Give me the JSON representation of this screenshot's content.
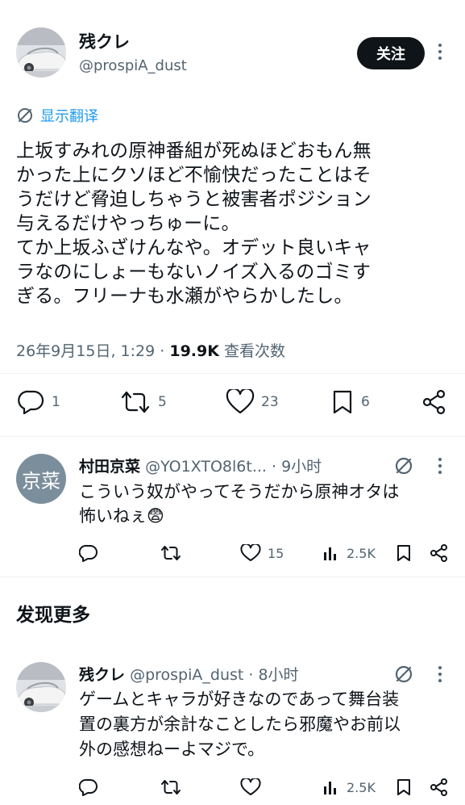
{
  "main_tweet": {
    "author_name": "残クレ",
    "author_handle": "@prospiA_dust",
    "follow_label": "关注",
    "translate_label": "显示翻译",
    "lines": [
      "上坂すみれの原神番組が死ぬほどおもん無",
      "かった上にクソほど不愉快だったことはそ",
      "うだけど脅迫しちゃうと被害者ポジション",
      "与えるだけやっちゅーに。",
      "てか上坂ふざけんなや。オデット良いキャ",
      "ラなのにしょーもないノイズ入るのゴミす",
      "ぎる。フリーナも水瀬がやらかしたし。"
    ],
    "timestamp": "26年9月15日, 1:29",
    "views_count": "19.9K",
    "views_label": "查看次数",
    "separator": "·",
    "replies": "1",
    "retweets": "5",
    "likes": "23",
    "bookmarks": "6"
  },
  "reply": {
    "avatar_text": "京菜",
    "author_name": "村田京菜",
    "author_handle": "@YO1XTO8l6t...",
    "time": "· 9小时",
    "lines": [
      "こういう奴がやってそうだから原神オタは",
      "怖いねぇ😨"
    ],
    "likes": "15",
    "views": "2.5K"
  },
  "discover": {
    "title": "发现更多",
    "tweet": {
      "author_name": "残クレ",
      "author_handle": "@prospiA_dust",
      "time": "· 8小时",
      "lines": [
        "ゲームとキャラが好きなのであって舞台装",
        "置の裏方が余計なことしたら邪魔やお前以",
        "外の感想ねーよマジで。"
      ],
      "views": "2.5K"
    }
  },
  "colors": {
    "accent": "#1d9bf0",
    "text": "#0f1419",
    "muted": "#536471",
    "avatar_bg": "#7b8e9c"
  }
}
